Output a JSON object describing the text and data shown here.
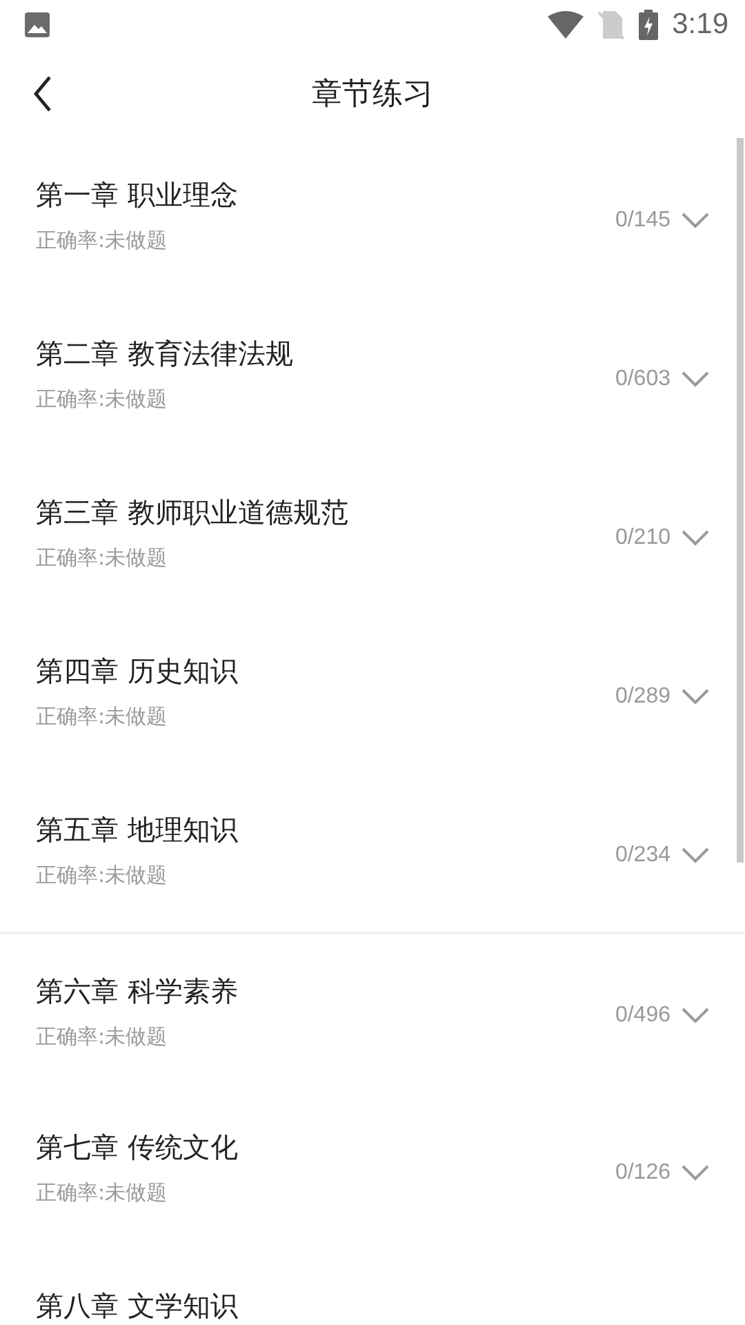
{
  "status_bar": {
    "time": "3:19"
  },
  "header": {
    "title": "章节练习"
  },
  "chapters": [
    {
      "title": "第一章 职业理念",
      "accuracy": "正确率:未做题",
      "count": "0/145",
      "separated": false
    },
    {
      "title": "第二章 教育法律法规",
      "accuracy": "正确率:未做题",
      "count": "0/603",
      "separated": false
    },
    {
      "title": "第三章 教师职业道德规范",
      "accuracy": "正确率:未做题",
      "count": "0/210",
      "separated": false
    },
    {
      "title": "第四章 历史知识",
      "accuracy": "正确率:未做题",
      "count": "0/289",
      "separated": false
    },
    {
      "title": "第五章 地理知识",
      "accuracy": "正确率:未做题",
      "count": "0/234",
      "separated": false
    },
    {
      "title": "第六章 科学素养",
      "accuracy": "正确率:未做题",
      "count": "0/496",
      "separated": true
    },
    {
      "title": "第七章 传统文化",
      "accuracy": "正确率:未做题",
      "count": "0/126",
      "separated": false
    },
    {
      "title": "第八章 文学知识",
      "separated": false
    }
  ]
}
